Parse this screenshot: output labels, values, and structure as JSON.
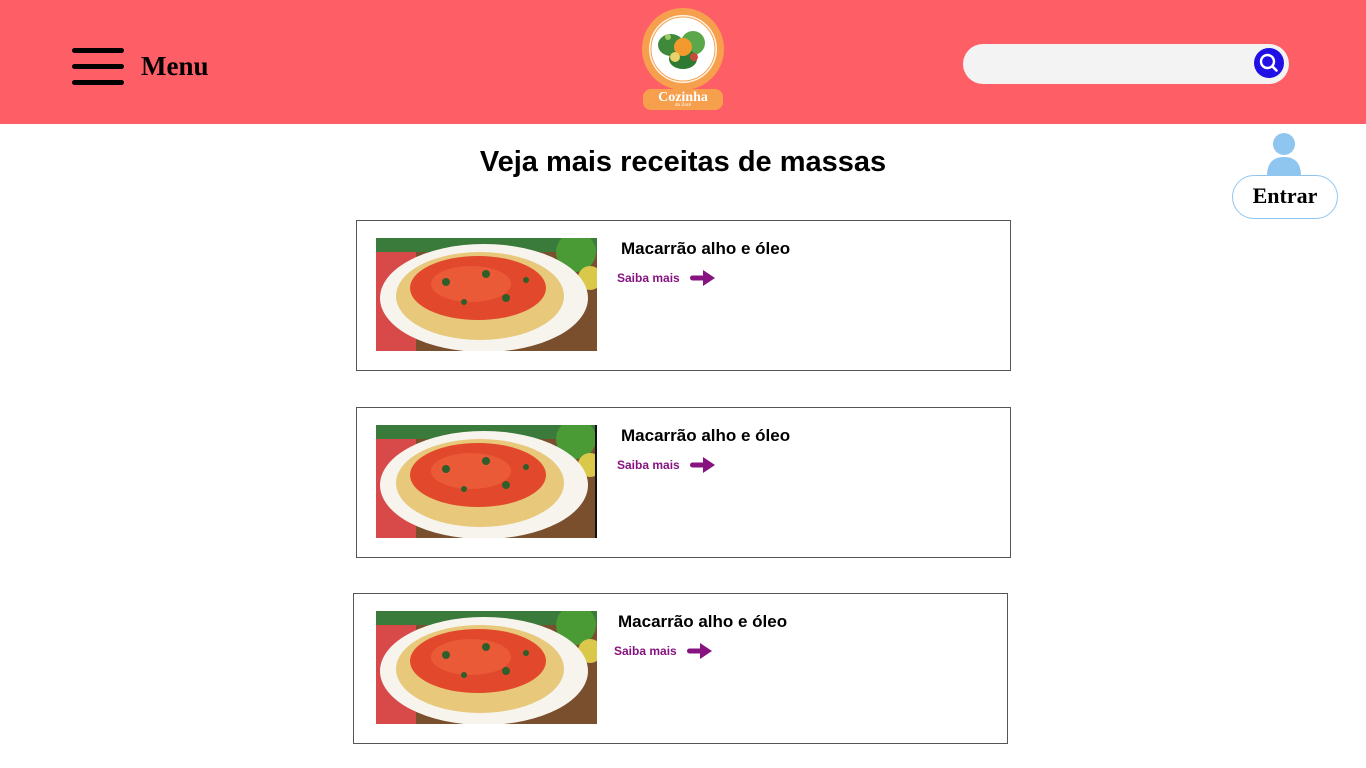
{
  "header": {
    "menu_label": "Menu",
    "logo_text": "Cozinha",
    "logo_subtext": "do Zezé",
    "search": {
      "value": "",
      "placeholder": ""
    },
    "brand_color": "#fe5f67",
    "search_button_color": "#2010e6",
    "login_label": "Entrar"
  },
  "main": {
    "title": "Veja mais receitas de massas",
    "recipes": [
      {
        "title": "Macarrão alho e óleo",
        "link_label": "Saiba mais"
      },
      {
        "title": "Macarrão alho e óleo",
        "link_label": "Saiba mais"
      },
      {
        "title": "Macarrão alho e óleo",
        "link_label": "Saiba mais"
      }
    ],
    "link_color": "#861380"
  },
  "icons": [
    "hamburger-menu-icon",
    "search-icon",
    "user-icon",
    "arrow-right-icon"
  ]
}
